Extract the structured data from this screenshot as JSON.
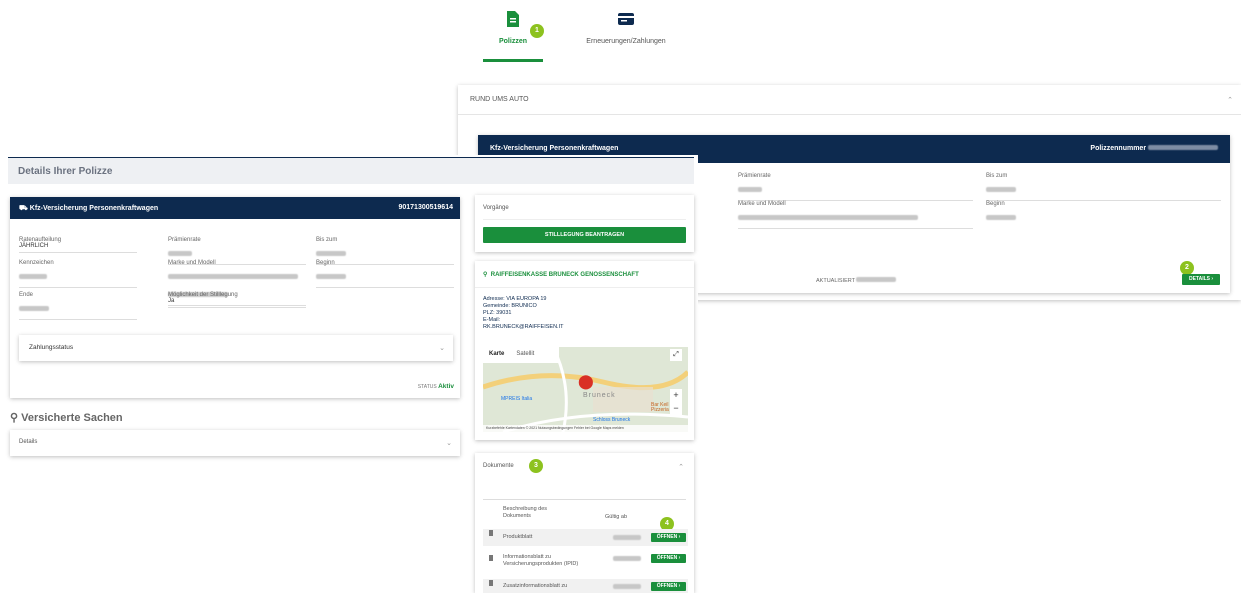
{
  "tabs": [
    {
      "label": "Polizzen",
      "badge": "1",
      "icon": "document-icon",
      "active": true
    },
    {
      "label": "Erneuerungen/Zahlungen",
      "icon": "card-icon",
      "active": false
    }
  ],
  "back_panel": {
    "section": "RUND UMS AUTO",
    "card_title": "Kfz-Versicherung Personenkraftwagen",
    "policy_label": "Polizzennummer",
    "fields": [
      {
        "label": "Prämienrate"
      },
      {
        "label": "Bis zum"
      },
      {
        "label": "Marke und Modell"
      },
      {
        "label": "Beginn"
      }
    ],
    "updated_label": "AKTUALISIERT",
    "details_button": "DETAILS",
    "badge": "2"
  },
  "page_title": "Details Ihrer Polizze",
  "policy_card": {
    "title": "Kfz-Versicherung Personenkraftwagen",
    "number": "90171300519614",
    "fields": [
      {
        "label": "Ratenaufteilung",
        "value": "JÄHRLICH"
      },
      {
        "label": "Prämienrate",
        "value": ""
      },
      {
        "label": "Bis zum",
        "value": ""
      },
      {
        "label": "Kennzeichen",
        "value": ""
      },
      {
        "label": "Marke und Modell",
        "value": ""
      },
      {
        "label": "Beginn",
        "value": ""
      },
      {
        "label": "Ende",
        "value": ""
      },
      {
        "label": "Möglichkeit der Stilllegung",
        "value": "Ja"
      }
    ],
    "payment_status": "Zahlungsstatus",
    "status_label": "STATUS",
    "status_value": "Aktiv"
  },
  "insured": {
    "title": "Versicherte Sachen",
    "details": "Details"
  },
  "processes": {
    "title": "Vorgänge",
    "button": "STILLLEGUNG BEANTRAGEN"
  },
  "bank": {
    "name": "RAIFFEISENKASSE BRUNECK GENOSSENSCHAFT",
    "address": "Adresse: VIA EUROPA 19",
    "municipality": "Gemeinde: BRUNICO",
    "zip": "PLZ: 39031",
    "email_label": "E-Mail:",
    "email": "RK.BRUNECK@RAIFFEISEN.IT",
    "map_tab_map": "Karte",
    "map_tab_sat": "Satellit",
    "map_city": "Bruneck",
    "map_labels": [
      "MPREIS Italia",
      "Schloss Bruneck",
      "Pizzeria",
      "Bar Keil"
    ],
    "map_footer": "Kurzbefehle   Kartendaten © 2021   Nutzungsbedingungen   Fehler bei Google Maps melden"
  },
  "documents": {
    "title": "Dokumente",
    "badge3": "3",
    "badge4": "4",
    "col_desc": "Beschreibung des Dokuments",
    "col_valid": "Gültig ab",
    "rows": [
      {
        "name": "Produktblatt",
        "button": "ÖFFNEN"
      },
      {
        "name": "Informationsblatt zu Versicherungsprodukten (IPID)",
        "button": "ÖFFNEN"
      },
      {
        "name": "Zusatzinformationsblatt zu",
        "button": "ÖFFNEN"
      }
    ]
  },
  "colors": {
    "navy": "#0d2a4f",
    "green": "#1a8f3c",
    "badge": "#8dc21f"
  }
}
